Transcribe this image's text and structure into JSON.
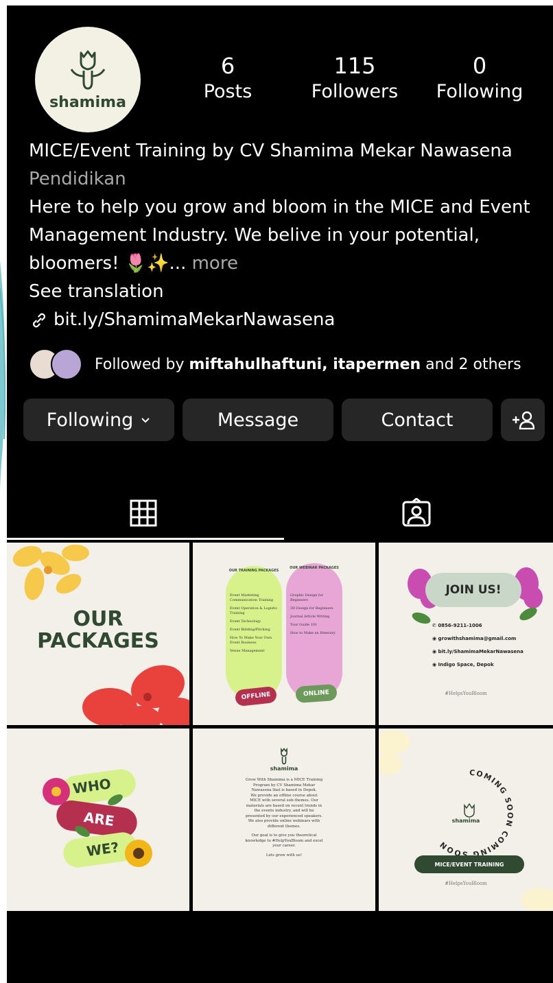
{
  "profile": {
    "logo_text": "shamima",
    "stats": [
      {
        "value": "6",
        "label": "Posts"
      },
      {
        "value": "115",
        "label": "Followers"
      },
      {
        "value": "0",
        "label": "Following"
      }
    ],
    "name": "MICE/Event Training by CV Shamima Mekar Nawasena",
    "category": "Pendidikan",
    "bio_line1": "Here to help you grow and bloom in the MICE and Event",
    "bio_line2": "Management Industry. We belive in your potential,",
    "bio_line3": "bloomers! 🌷✨...",
    "more": " more",
    "see_translation": "See translation",
    "link": "bit.ly/ShamimaMekarNawasena",
    "followed_by_prefix": "Followed by ",
    "followed_by_names": "miftahulhaftuni, itapermen",
    "followed_by_suffix": " and 2 others"
  },
  "actions": {
    "following": "Following",
    "message": "Message",
    "contact": "Contact"
  },
  "posts": {
    "p1": {
      "line1": "OUR",
      "line2": "PACKAGES"
    },
    "p2": {
      "left_title": "OUR TRAINING PACKAGES",
      "right_title": "OUR WEBINAR PACKAGES",
      "left_items": [
        "Event Marketing Communication Training",
        "Event Operation & Logistic Training",
        "Event Technology",
        "Event Bidding/Pitching",
        "How To Make Your Own Event Business",
        "Venue Management"
      ],
      "right_items": [
        "Graphic Design for Beginners",
        "3D Design for Beginners",
        "Journal Article Writing",
        "Tour Guide 101",
        "How to Make an Itinerary"
      ],
      "left_badge": "OFFLINE",
      "right_badge": "ONLINE"
    },
    "p3": {
      "title": "JOIN US!",
      "phone": "0856-9211-1006",
      "email": "growithshamima@gmail.com",
      "link": "bit.ly/ShamimaMekarNawasena",
      "place": "Indigo Space, Depok",
      "hashtag": "#HelpsYouBloom"
    },
    "p4": {
      "w1": "WHO",
      "w2": "ARE",
      "w3": "WE?"
    },
    "p5": {
      "logo_text": "shamima",
      "para1": "Grow With Shamima is a MICE Training Program by CV Shamima Mekar Nawasena that is based in Depok.",
      "para2": "We provide an offline course about MICE with several sub-themes. Our materials are based on recent trends in the events industry, and will be presented by our experienced speakers.",
      "para3": "We also provide online webinars with different themes.",
      "para4": "Our goal is to give you theoretical knowledge to #HelpYouBloom and excel your career.",
      "para5": "Lets grow with us!"
    },
    "p6": {
      "ring_text": "COMING SOON COMING SOON",
      "logo_text": "shamima",
      "banner": "MICE/EVENT TRAINING",
      "hashtag": "#HelpsYouBloom"
    }
  },
  "colors": {
    "button_bg": "#262626",
    "post_bg": "#f2f0e8",
    "brand_green": "#2f4a30",
    "lime": "#d7f28a",
    "pink": "#e7a6d6"
  }
}
